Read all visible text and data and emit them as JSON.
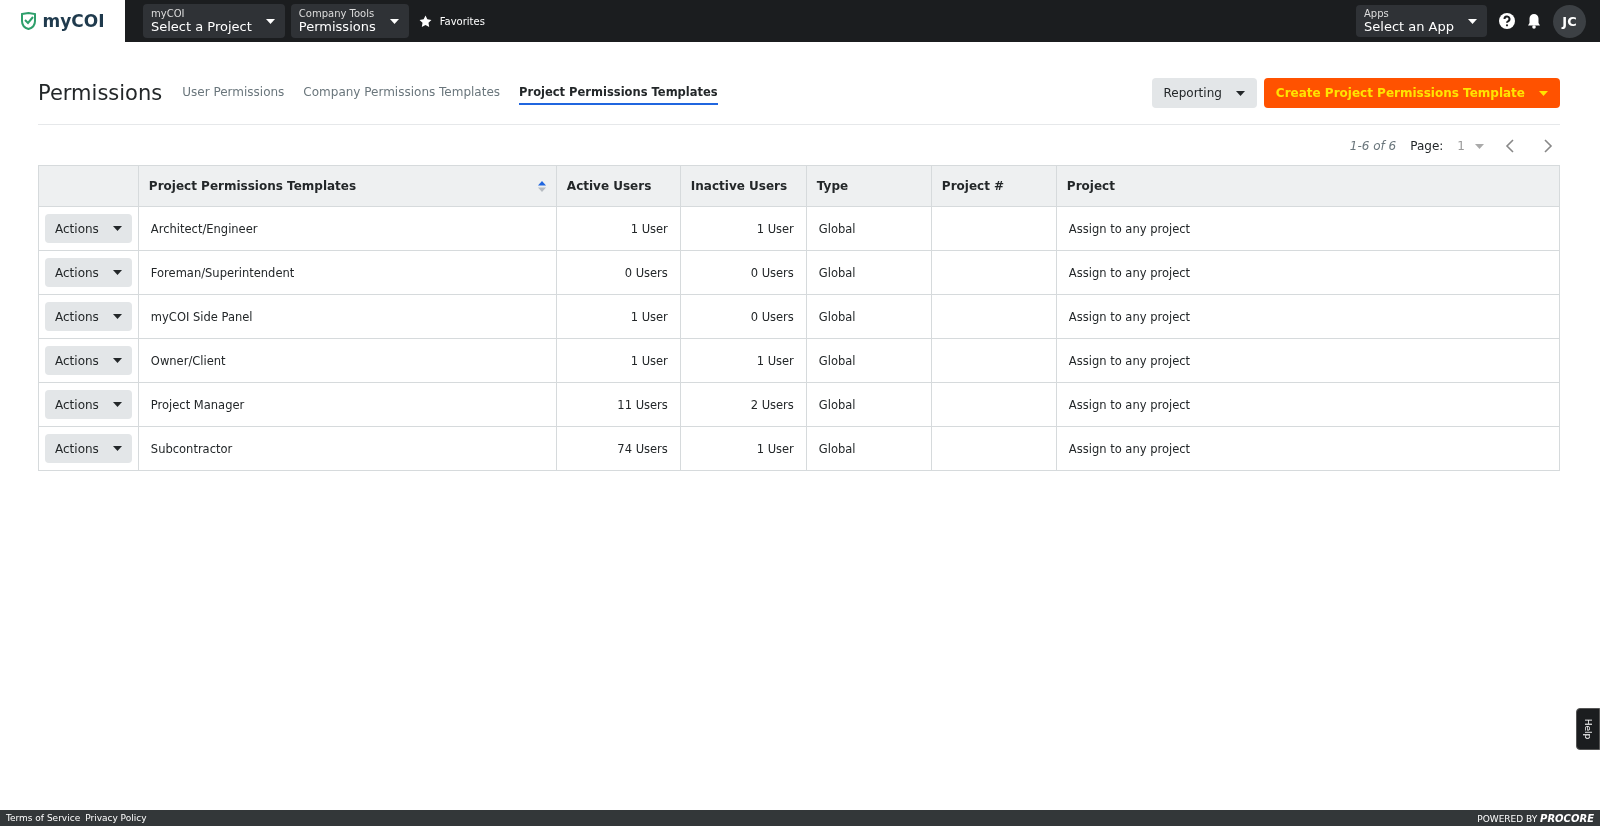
{
  "topbar": {
    "logo": "myCOI",
    "pickers": [
      {
        "label": "myCOI",
        "value": "Select a Project"
      },
      {
        "label": "Company Tools",
        "value": "Permissions"
      }
    ],
    "favorites": "Favorites",
    "apps": {
      "label": "Apps",
      "value": "Select an App"
    },
    "avatar": "JC"
  },
  "header": {
    "title": "Permissions",
    "tabs": [
      {
        "label": "User Permissions",
        "selected": false
      },
      {
        "label": "Company Permissions Templates",
        "selected": false
      },
      {
        "label": "Project Permissions Templates",
        "selected": true
      }
    ],
    "buttons": [
      {
        "label": "Reporting",
        "kind": "secondary"
      },
      {
        "label": "Create Project Permissions Template",
        "kind": "primary"
      }
    ]
  },
  "pagination": {
    "range": "1-6 of 6",
    "page_label": "Page:",
    "page": "1"
  },
  "table": {
    "columns": [
      {
        "label": "Project Permissions Templates",
        "sorted": true
      },
      {
        "label": "Active Users",
        "sorted": false
      },
      {
        "label": "Inactive Users",
        "sorted": false
      },
      {
        "label": "Type",
        "sorted": false
      },
      {
        "label": "Project #",
        "sorted": false
      },
      {
        "label": "Project",
        "sorted": false
      }
    ],
    "rows": [
      {
        "action": "Actions",
        "name": "Architect/Engineer",
        "active": "1 User",
        "inactive": "1 User",
        "type": "Global",
        "project": "Assign to any project"
      },
      {
        "action": "Actions",
        "name": "Foreman/Superintendent",
        "active": "0 Users",
        "inactive": "0 Users",
        "type": "Global",
        "project": "Assign to any project"
      },
      {
        "action": "Actions",
        "name": "myCOI Side Panel",
        "active": "1 User",
        "inactive": "0 Users",
        "type": "Global",
        "project": "Assign to any project"
      },
      {
        "action": "Actions",
        "name": "Owner/Client",
        "active": "1 User",
        "inactive": "1 User",
        "type": "Global",
        "project": "Assign to any project"
      },
      {
        "action": "Actions",
        "name": "Project Manager",
        "active": "11 Users",
        "inactive": "2 Users",
        "type": "Global",
        "project": "Assign to any project"
      },
      {
        "action": "Actions",
        "name": "Subcontractor",
        "active": "74 Users",
        "inactive": "1 User",
        "type": "Global",
        "project": "Assign to any project"
      }
    ]
  },
  "help": "Help",
  "footer": {
    "links": [
      "Terms of Service",
      "Privacy Policy"
    ],
    "powered": "POWERED BY **PROCORE**"
  }
}
